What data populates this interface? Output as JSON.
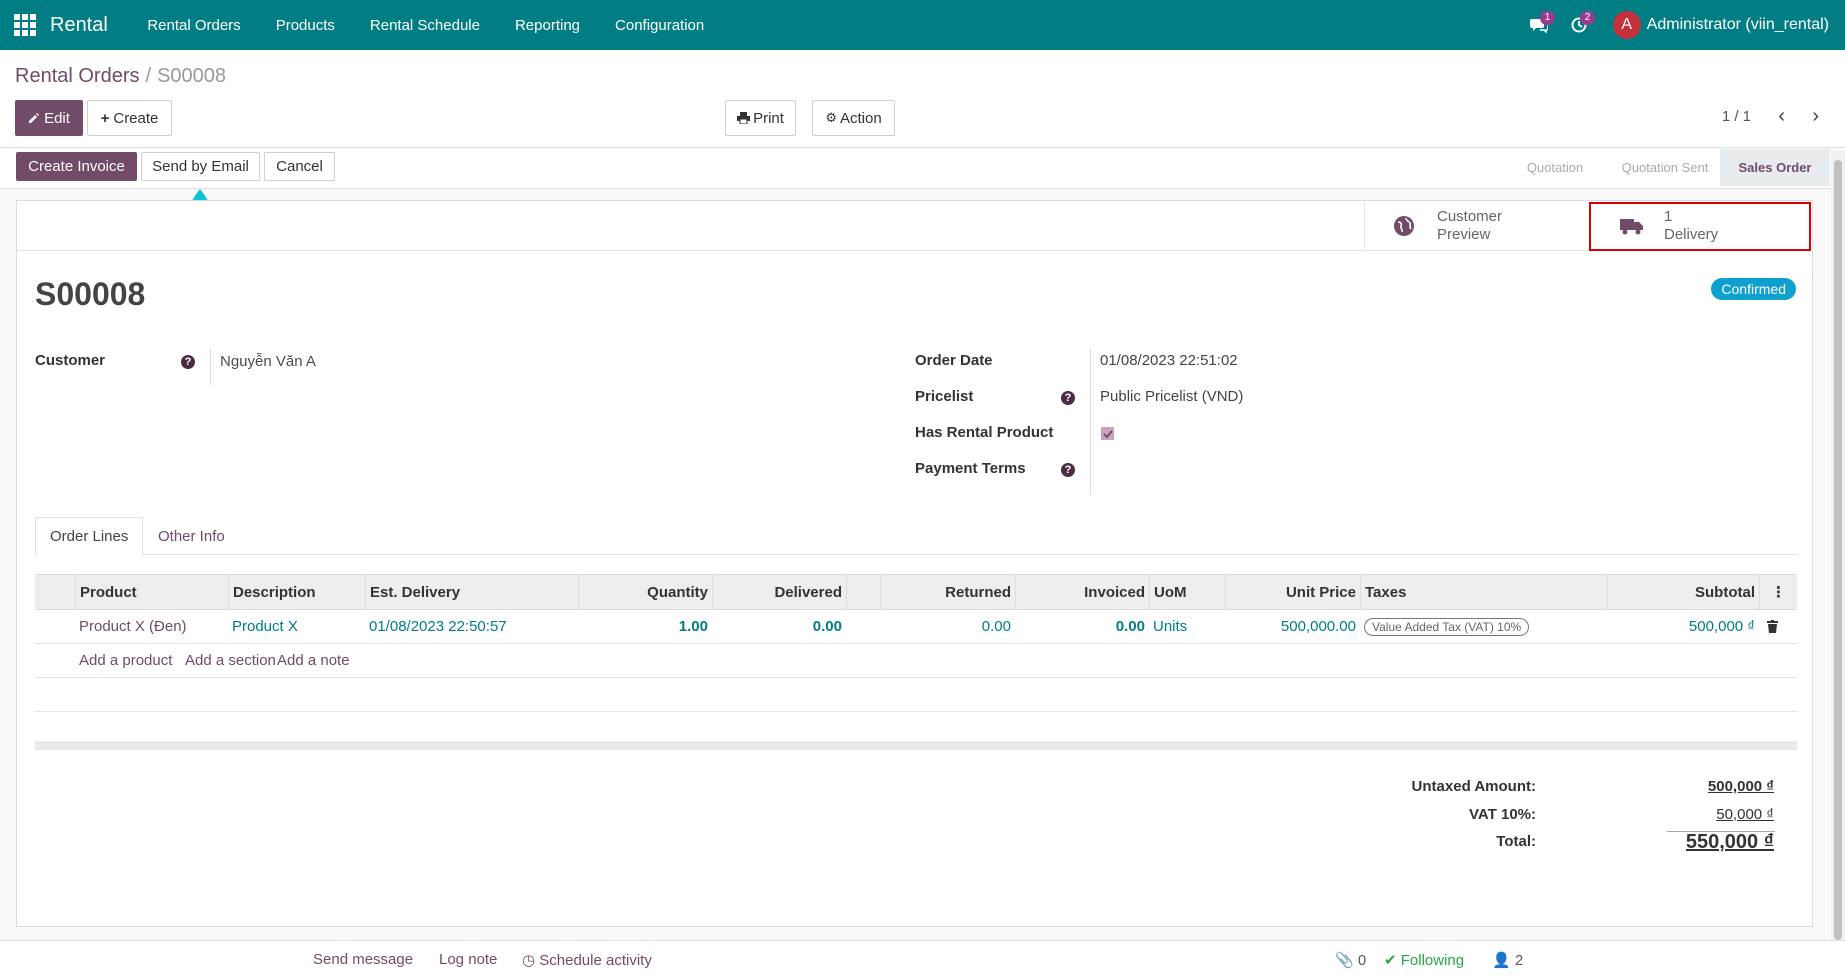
{
  "navbar": {
    "brand": "Rental",
    "menu": [
      "Rental Orders",
      "Products",
      "Rental Schedule",
      "Reporting",
      "Configuration"
    ],
    "messages_count": "1",
    "activities_count": "2",
    "avatar_letter": "A",
    "user": "Administrator (viin_rental)"
  },
  "breadcrumb": {
    "parent": "Rental Orders",
    "separator": "/",
    "current": "S00008"
  },
  "toolbar": {
    "edit": "Edit",
    "create": "Create",
    "print": "Print",
    "action": "Action",
    "pager": "1 / 1"
  },
  "statusbar": {
    "buttons": {
      "create_invoice": "Create Invoice",
      "send_email": "Send by Email",
      "cancel": "Cancel"
    },
    "stages": [
      "Quotation",
      "Quotation Sent",
      "Sales Order"
    ],
    "active_stage": "Sales Order"
  },
  "smart_buttons": {
    "customer_preview": [
      "Customer",
      "Preview"
    ],
    "delivery": {
      "count": "1",
      "label": "Delivery"
    }
  },
  "order": {
    "name": "S00008",
    "state": "Confirmed",
    "customer_label": "Customer",
    "customer": "Nguyễn Văn A",
    "order_date_label": "Order Date",
    "order_date": "01/08/2023 22:51:02",
    "pricelist_label": "Pricelist",
    "pricelist": "Public Pricelist (VND)",
    "has_rental_label": "Has Rental Product",
    "has_rental": true,
    "payment_terms_label": "Payment Terms",
    "payment_terms": ""
  },
  "tabs": [
    "Order Lines",
    "Other Info"
  ],
  "table": {
    "headers": [
      "Product",
      "Description",
      "Est. Delivery",
      "Quantity",
      "Delivered",
      "Returned",
      "Invoiced",
      "UoM",
      "Unit Price",
      "Taxes",
      "Subtotal"
    ],
    "rows": [
      {
        "product": "Product X (Đen)",
        "description": "Product X",
        "est_delivery": "01/08/2023 22:50:57",
        "quantity": "1.00",
        "delivered": "0.00",
        "returned": "0.00",
        "invoiced": "0.00",
        "uom": "Units",
        "unit_price": "500,000.00",
        "taxes": "Value Added Tax (VAT) 10%",
        "subtotal": "500,000 ₫"
      }
    ],
    "add_links": [
      "Add a product",
      "Add a section",
      "Add a note"
    ]
  },
  "totals": {
    "untaxed_label": "Untaxed Amount:",
    "untaxed": "500,000 ₫",
    "vat_label": "VAT 10%:",
    "vat": "50,000 ₫",
    "total_label": "Total:",
    "total": "550,000 ₫"
  },
  "chatter": {
    "send_message": "Send message",
    "log_note": "Log note",
    "schedule_activity": "Schedule activity",
    "attachments": "0",
    "following": "Following",
    "followers": "2"
  },
  "colors": {
    "navbar": "#017e84",
    "primary": "#714b67",
    "highlight": "#d90000",
    "badge": "#0fa0cf"
  }
}
